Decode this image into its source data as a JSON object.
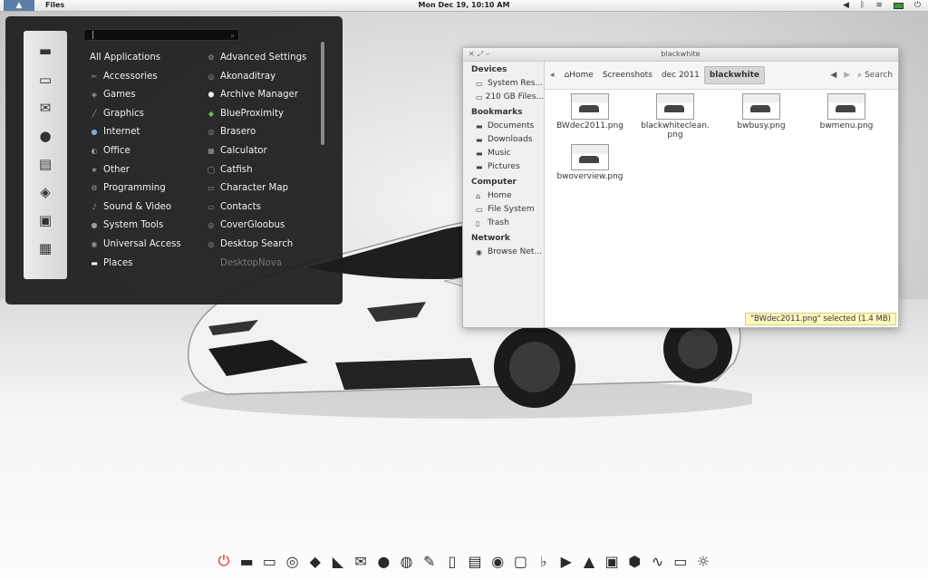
{
  "panel": {
    "app_name": "Files",
    "clock": "Mon Dec 19, 10:10 AM",
    "tray_icons": [
      "volume-icon",
      "bluetooth-icon",
      "wifi-icon",
      "battery-icon",
      "power-icon"
    ]
  },
  "launcher": {
    "search_value": "|",
    "dock_icons": [
      "monitor-icon",
      "terminal-icon",
      "mail-icon",
      "messaging-icon",
      "document-icon",
      "games-icon",
      "photo-icon",
      "network-icon"
    ],
    "categories": [
      {
        "label": "All Applications",
        "icon": ""
      },
      {
        "label": "Accessories",
        "icon": "accessories-icon"
      },
      {
        "label": "Games",
        "icon": "games-icon"
      },
      {
        "label": "Graphics",
        "icon": "graphics-icon"
      },
      {
        "label": "Internet",
        "icon": "internet-icon"
      },
      {
        "label": "Office",
        "icon": "office-icon"
      },
      {
        "label": "Other",
        "icon": "other-icon"
      },
      {
        "label": "Programming",
        "icon": "programming-icon"
      },
      {
        "label": "Sound & Video",
        "icon": "sound-video-icon"
      },
      {
        "label": "System Tools",
        "icon": "system-tools-icon"
      },
      {
        "label": "Universal Access",
        "icon": "universal-access-icon"
      },
      {
        "label": "Places",
        "icon": "folder-icon"
      }
    ],
    "apps": [
      {
        "label": "Advanced Settings"
      },
      {
        "label": "Akonaditray"
      },
      {
        "label": "Archive Manager"
      },
      {
        "label": "BlueProximity"
      },
      {
        "label": "Brasero"
      },
      {
        "label": "Calculator"
      },
      {
        "label": "Catfish"
      },
      {
        "label": "Character Map"
      },
      {
        "label": "Contacts"
      },
      {
        "label": "CoverGloobus"
      },
      {
        "label": "Desktop Search"
      },
      {
        "label": "DesktopNova"
      }
    ]
  },
  "file_manager": {
    "title": "blackwhite",
    "sidebar": {
      "devices_header": "Devices",
      "devices": [
        "System Res...",
        "210 GB Files..."
      ],
      "bookmarks_header": "Bookmarks",
      "bookmarks": [
        "Documents",
        "Downloads",
        "Music",
        "Pictures"
      ],
      "computer_header": "Computer",
      "computer": [
        "Home",
        "File System",
        "Trash"
      ],
      "network_header": "Network",
      "network": [
        "Browse Net..."
      ]
    },
    "breadcrumbs": [
      "Home",
      "Screenshots",
      "dec 2011",
      "blackwhite"
    ],
    "search_label": "Search",
    "files": [
      {
        "name": "BWdec2011.png"
      },
      {
        "name": "blackwhiteclean.\npng"
      },
      {
        "name": "bwbusy.png"
      },
      {
        "name": "bwmenu.png"
      },
      {
        "name": "bwoverview.png"
      }
    ],
    "status": "\"BWdec2011.png\" selected (1.4 MB)"
  },
  "bottom_dock": [
    "power-icon",
    "monitor-icon",
    "terminal-icon",
    "chrome-icon",
    "leaf-icon",
    "rss-icon",
    "mail-icon",
    "chat-icon",
    "speech-bubble-icon",
    "pen-icon",
    "document-icon",
    "printer-icon",
    "firefox-icon",
    "window-icon",
    "beatbox-icon",
    "media-player-icon",
    "vlc-icon",
    "image-viewer-icon",
    "cube-icon",
    "activity-icon",
    "screen-icon",
    "weather-icon"
  ]
}
